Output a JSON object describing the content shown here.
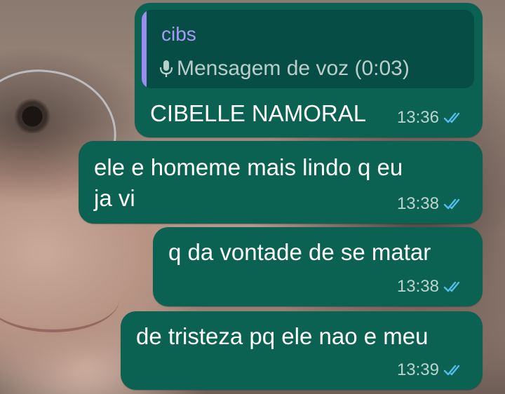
{
  "messages": [
    {
      "quoted": {
        "sender": "cibs",
        "label": "Mensagem de voz (0:03)",
        "icon": "microphone-icon"
      },
      "text": "CIBELLE NAMORAL",
      "time": "13:36",
      "status": "read"
    },
    {
      "text_line1": "ele e homeme mais lindo q eu",
      "text_line2": "ja vi",
      "time": "13:38",
      "status": "read"
    },
    {
      "text": "q da vontade de se matar",
      "time": "13:38",
      "status": "read"
    },
    {
      "text": "de tristeza pq ele nao e meu",
      "time": "13:39",
      "status": "read"
    }
  ],
  "colors": {
    "bubble": "#0b6152",
    "quote_bg": "#064e45",
    "quote_bar": "#9c8cf0",
    "read_ticks": "#53bdeb"
  }
}
